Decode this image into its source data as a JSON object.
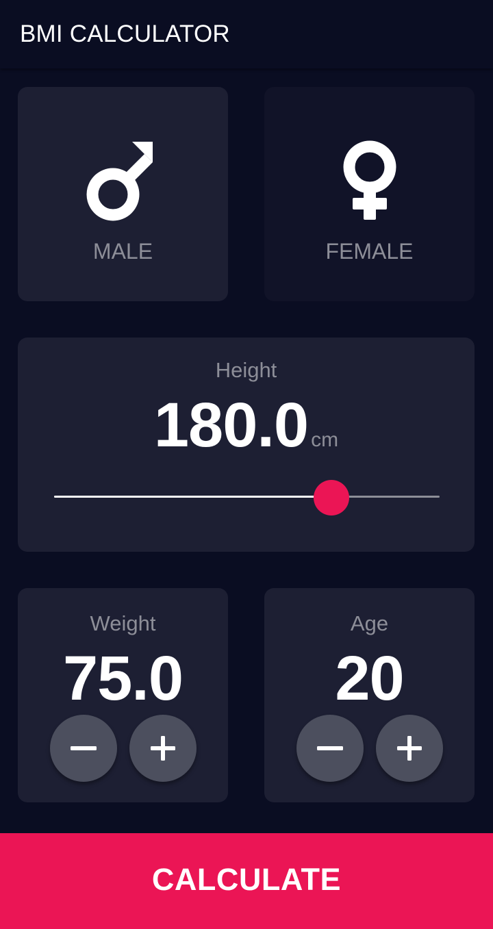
{
  "app": {
    "title": "BMI CALCULATOR"
  },
  "gender": {
    "selected": "male",
    "male": {
      "label": "MALE",
      "icon": "mars-icon"
    },
    "female": {
      "label": "FEMALE",
      "icon": "venus-icon"
    }
  },
  "height": {
    "label": "Height",
    "value": "180.0",
    "unit": "cm",
    "slider_fraction": 0.719
  },
  "weight": {
    "label": "Weight",
    "value": "75.0"
  },
  "age": {
    "label": "Age",
    "value": "20"
  },
  "actions": {
    "calculate_label": "CALCULATE"
  },
  "colors": {
    "background": "#0a0d22",
    "active_card": "#1d1f33",
    "inactive_card": "#111328",
    "accent": "#eb1555",
    "label_grey": "#8d8e98",
    "round_button": "#4c4f5e"
  }
}
